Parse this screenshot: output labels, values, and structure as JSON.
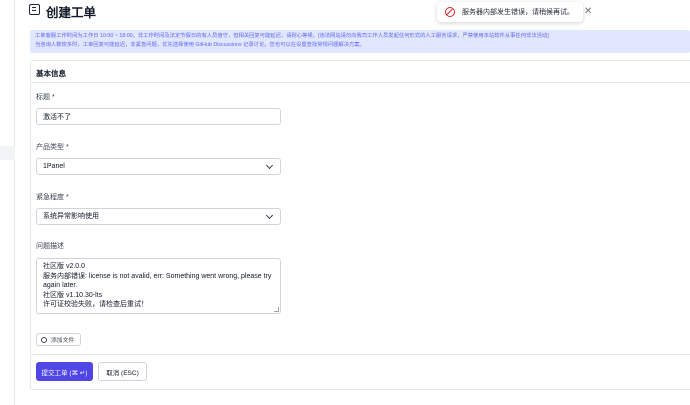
{
  "page": {
    "title": "创建工单"
  },
  "toast": {
    "message": "服务器内部发生错误，请稍候再试。",
    "close_glyph": "✕",
    "icon": "error-circle-icon"
  },
  "notice": {
    "line1": "工单客服工作时间为工作日 10:00 ~ 18:00。非工作时间及法定节假日的有人员值守，但相关回复可能延迟，请耐心等候。[违法网站请勿向我司工作人员发起任何形式的人工服务请求，严禁使用本站软件从事任何非法活动]",
    "line2": "当咨询人数较多时，工单回复可能延迟，非紧急问题，优先选择使用 GitHub Discussions 记录讨论。您也可以在设置查找常规问题解决方案。"
  },
  "form": {
    "section_title": "基本信息",
    "title_label": "标题 *",
    "title_value": "激活不了",
    "product_label": "产品类型 *",
    "product_value": "1Panel",
    "urgency_label": "紧急程度 *",
    "urgency_value": "系统异常影响使用",
    "desc_label": "问题描述",
    "desc_lines": [
      "社区版 v2.0.0",
      "服务内部错误: license is not avalid, err: Something went wrong, please try",
      "again later.",
      "社区版 v1.10.30-lts",
      "许可证校验失败，请检查后重试！"
    ],
    "attach_label": "添加文件",
    "submit_label": "提交工单 (⌘ ↵)",
    "cancel_label": "取消 (ESC)"
  },
  "colors": {
    "accent": "#4f46e5",
    "notice_bg": "#e0e7ff",
    "notice_text": "#6366f1",
    "error": "#dc2626"
  }
}
